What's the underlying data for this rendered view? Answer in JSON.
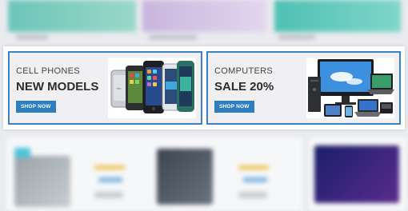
{
  "promos": [
    {
      "kicker": "CELL PHONES",
      "headline": "NEW MODELS",
      "button": "SHOP NOW",
      "image": "smartphones-image"
    },
    {
      "kicker": "COMPUTERS",
      "headline": "SALE 20%",
      "button": "SHOP NOW",
      "image": "computers-image"
    }
  ],
  "colors": {
    "accent": "#2e7fc1",
    "border": "#3b82c4",
    "panel": "#f0f0f2"
  }
}
